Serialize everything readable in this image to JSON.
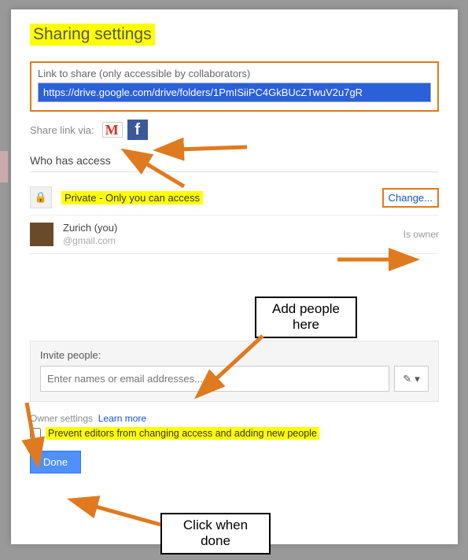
{
  "colors": {
    "highlight": "#ffff00",
    "annotation": "#e07a1f",
    "link": "#1155cc",
    "primaryBtn": "#4d90fe"
  },
  "title": "Sharing settings",
  "linkSection": {
    "label": "Link to share (only accessible by collaborators)",
    "value": "https://drive.google.com/drive/folders/1PmISiiPC4GkBUcZTwuV2u7gR"
  },
  "shareVia": {
    "label": "Share link via:",
    "icons": [
      "gmail-icon",
      "facebook-icon"
    ]
  },
  "whoHasAccess": {
    "heading": "Who has access",
    "privacy": {
      "icon": "lock-icon",
      "text": "Private - Only you can access",
      "changeLabel": "Change..."
    },
    "users": [
      {
        "name": "Zurich (you)",
        "email": "@gmail.com",
        "role": "Is owner"
      }
    ]
  },
  "invite": {
    "label": "Invite people:",
    "placeholder": "Enter names or email addresses...",
    "permIcon": "pencil-icon"
  },
  "ownerSettings": {
    "label": "Owner settings",
    "learnMore": "Learn more",
    "checkboxLabel": "Prevent editors from changing access and adding new people"
  },
  "buttons": {
    "done": "Done"
  },
  "annotations": {
    "addPeople": "Add people\nhere",
    "clickDone": "Click when\ndone"
  }
}
